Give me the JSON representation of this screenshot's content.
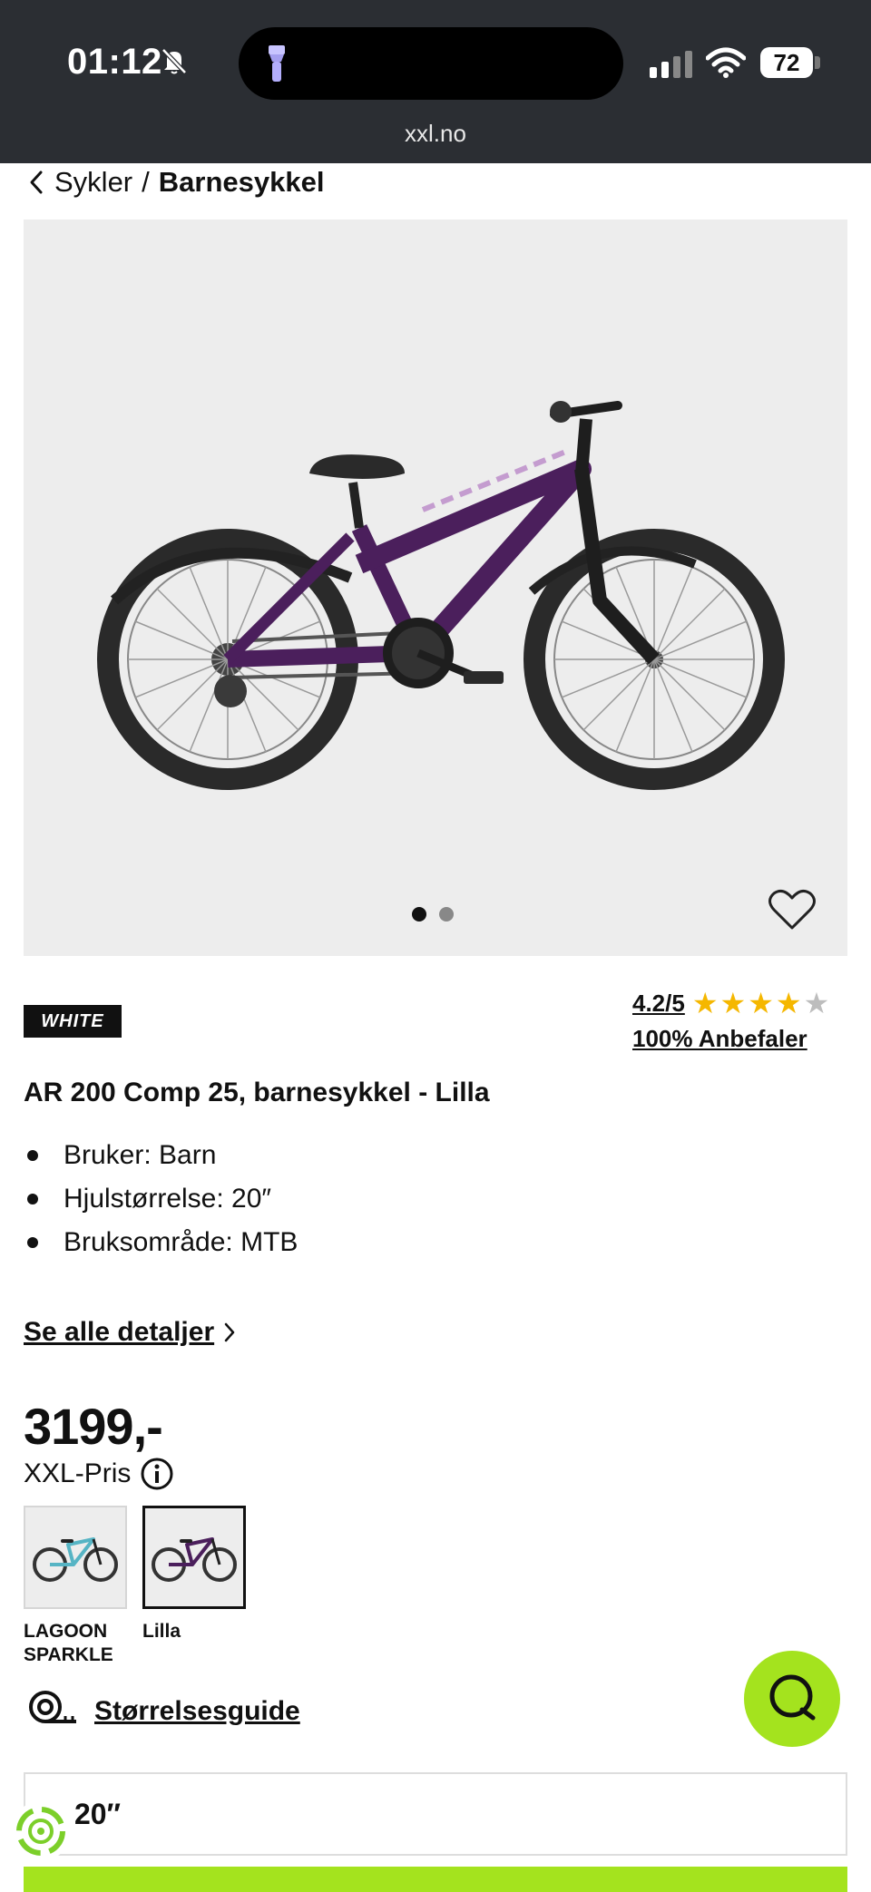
{
  "status_bar": {
    "time": "01:12",
    "battery": "72"
  },
  "browser": {
    "url": "xxl.no"
  },
  "breadcrumb": {
    "parent": "Sykler",
    "separator": "/",
    "current": "Barnesykkel"
  },
  "gallery": {
    "image_count": 2,
    "active_index": 0
  },
  "product": {
    "brand": "WHITE",
    "rating": "4.2/5",
    "rating_value": 4.2,
    "rating_max": 5,
    "recommend": "100% Anbefaler",
    "title": "AR 200 Comp 25, barnesykkel - Lilla",
    "bullets": [
      "Bruker: Barn",
      "Hjulstørrelse: 20″",
      "Bruksområde: MTB"
    ],
    "details_link": "Se alle detaljer",
    "price": "3199,-",
    "price_label": "XXL-Pris"
  },
  "variants": [
    {
      "label": "LAGOON SPARKLE",
      "color": "#56b4c4",
      "selected": false
    },
    {
      "label": "Lilla",
      "color": "#4b1f5c",
      "selected": true
    }
  ],
  "size_guide": {
    "label": "Størrelsesguide"
  },
  "size_select": {
    "value": "20″"
  },
  "colors": {
    "accent": "#a4e31e",
    "bike_frame": "#4b1f5c",
    "star": "#f5b700"
  },
  "icons": {
    "back": "chevron-left-icon",
    "favorite": "heart-icon",
    "info": "info-icon",
    "measure": "tape-measure-icon",
    "chat": "chat-icon",
    "eco": "recycle-icon"
  }
}
